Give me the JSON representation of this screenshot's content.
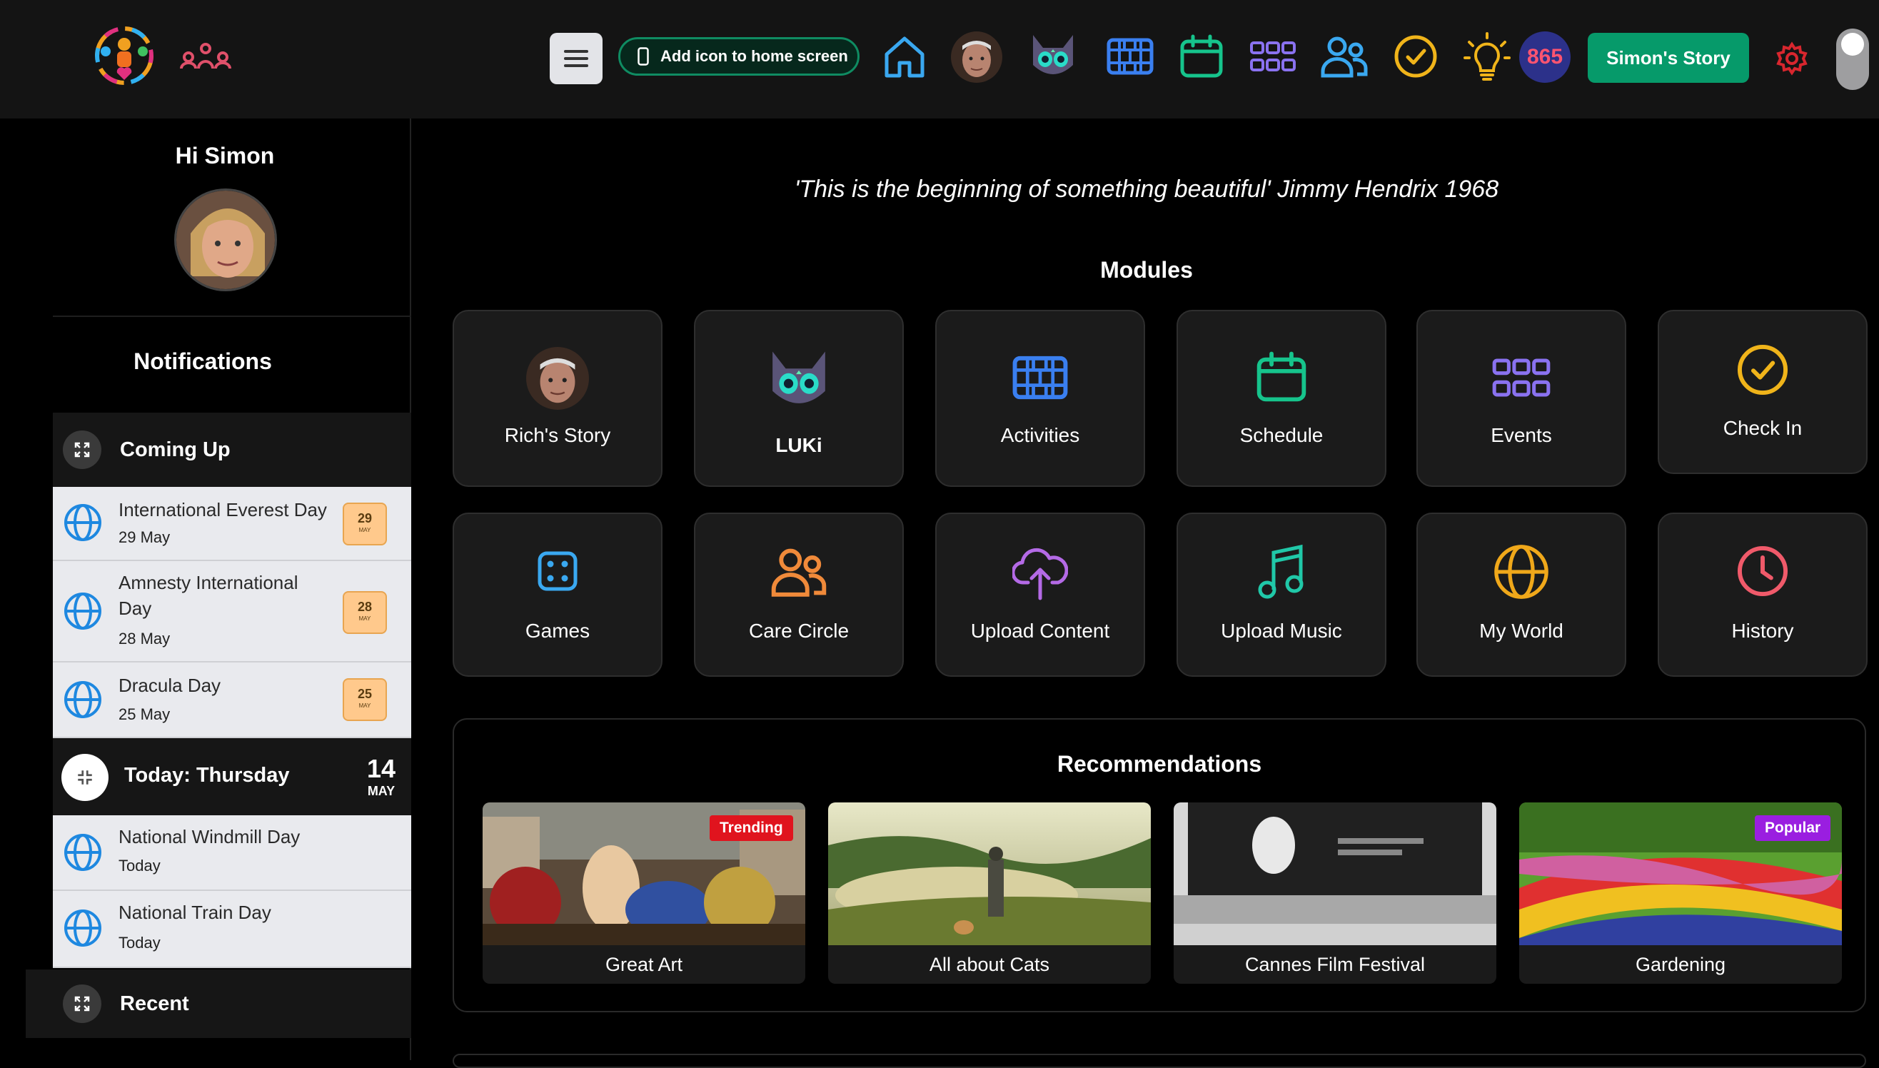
{
  "topbar": {
    "add_icon_label": "Add icon to home screen",
    "points": "865",
    "story_button": "Simon's Story",
    "icons": [
      "home-icon",
      "rich-avatar",
      "luki-cat-icon",
      "activities-icon",
      "schedule-icon",
      "events-icon",
      "care-circle-icon",
      "check-in-icon",
      "lightbulb-icon"
    ],
    "colors": {
      "home": "#3aa8f0",
      "activities": "#3a7ff0",
      "schedule": "#16c48c",
      "events": "#8a72f0",
      "people": "#3aa8f0",
      "check": "#f0b41a",
      "bulb": "#f0b41a",
      "settings": "#d8262e"
    }
  },
  "sidebar": {
    "greeting": "Hi Simon",
    "notifications_title": "Notifications",
    "coming_up_label": "Coming Up",
    "coming_up": [
      {
        "title": "International Everest Day",
        "date": "29 May",
        "day": "29",
        "month": "MAY"
      },
      {
        "title": "Amnesty International Day",
        "date": "28 May",
        "day": "28",
        "month": "MAY"
      },
      {
        "title": "Dracula Day",
        "date": "25 May",
        "day": "25",
        "month": "MAY"
      }
    ],
    "today_label": "Today: Thursday",
    "today_day": "14",
    "today_month": "MAY",
    "today": [
      {
        "title": "National Windmill Day",
        "date": "Today"
      },
      {
        "title": "National Train Day",
        "date": "Today"
      }
    ],
    "recent_label": "Recent"
  },
  "main": {
    "quote": "'This is the beginning of something beautiful' Jimmy Hendrix 1968",
    "modules_title": "Modules",
    "modules": [
      {
        "label": "Rich's Story",
        "icon": "rich-avatar",
        "color": "#ffffff"
      },
      {
        "label": "LUKi",
        "icon": "luki-cat-icon",
        "color": "#ffffff"
      },
      {
        "label": "Activities",
        "icon": "activities-icon",
        "color": "#3a7ff0"
      },
      {
        "label": "Schedule",
        "icon": "schedule-icon",
        "color": "#16c48c"
      },
      {
        "label": "Events",
        "icon": "events-icon",
        "color": "#8a72f0"
      },
      {
        "label": "Check In",
        "icon": "check-in-icon",
        "color": "#f0b41a"
      },
      {
        "label": "Games",
        "icon": "games-icon",
        "color": "#3aa8f0"
      },
      {
        "label": "Care Circle",
        "icon": "care-circle-icon",
        "color": "#f08a3a"
      },
      {
        "label": "Upload Content",
        "icon": "upload-cloud-icon",
        "color": "#b46ae6"
      },
      {
        "label": "Upload Music",
        "icon": "music-icon",
        "color": "#20c8a8"
      },
      {
        "label": "My World",
        "icon": "globe-icon",
        "color": "#f0a81a"
      },
      {
        "label": "History",
        "icon": "clock-icon",
        "color": "#f05a6a"
      }
    ],
    "recommendations_title": "Recommendations",
    "recommendations": [
      {
        "label": "Great Art",
        "badge": "Trending",
        "badge_color": "#e0141e"
      },
      {
        "label": "All about Cats",
        "badge": "",
        "badge_color": ""
      },
      {
        "label": "Cannes Film Festival",
        "badge": "",
        "badge_color": ""
      },
      {
        "label": "Gardening",
        "badge": "Popular",
        "badge_color": "#9a1ee0"
      }
    ]
  }
}
